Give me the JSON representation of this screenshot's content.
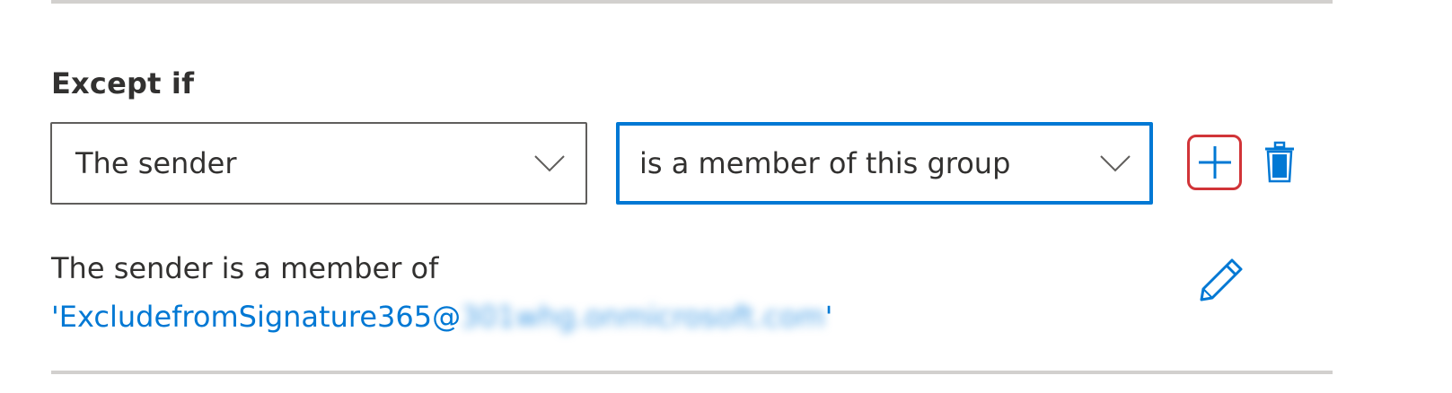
{
  "section": {
    "label": "Except if"
  },
  "condition": {
    "subject": {
      "value": "The sender",
      "icon": "chevron-down-icon"
    },
    "predicate": {
      "value": "is a member of this group",
      "icon": "chevron-down-icon"
    }
  },
  "actions": {
    "add_icon": "add-icon",
    "delete_icon": "delete-icon",
    "edit_icon": "edit-icon"
  },
  "summary": {
    "prefix": "The sender is a member of",
    "group_open": "'ExcludefromSignature365@",
    "group_domain_blurred": "301whg.onmicrosoft.com",
    "group_close": "'"
  },
  "colors": {
    "accent": "#0078d4",
    "highlight_border": "#d13438",
    "divider": "#d2d0ce",
    "text": "#323130"
  }
}
